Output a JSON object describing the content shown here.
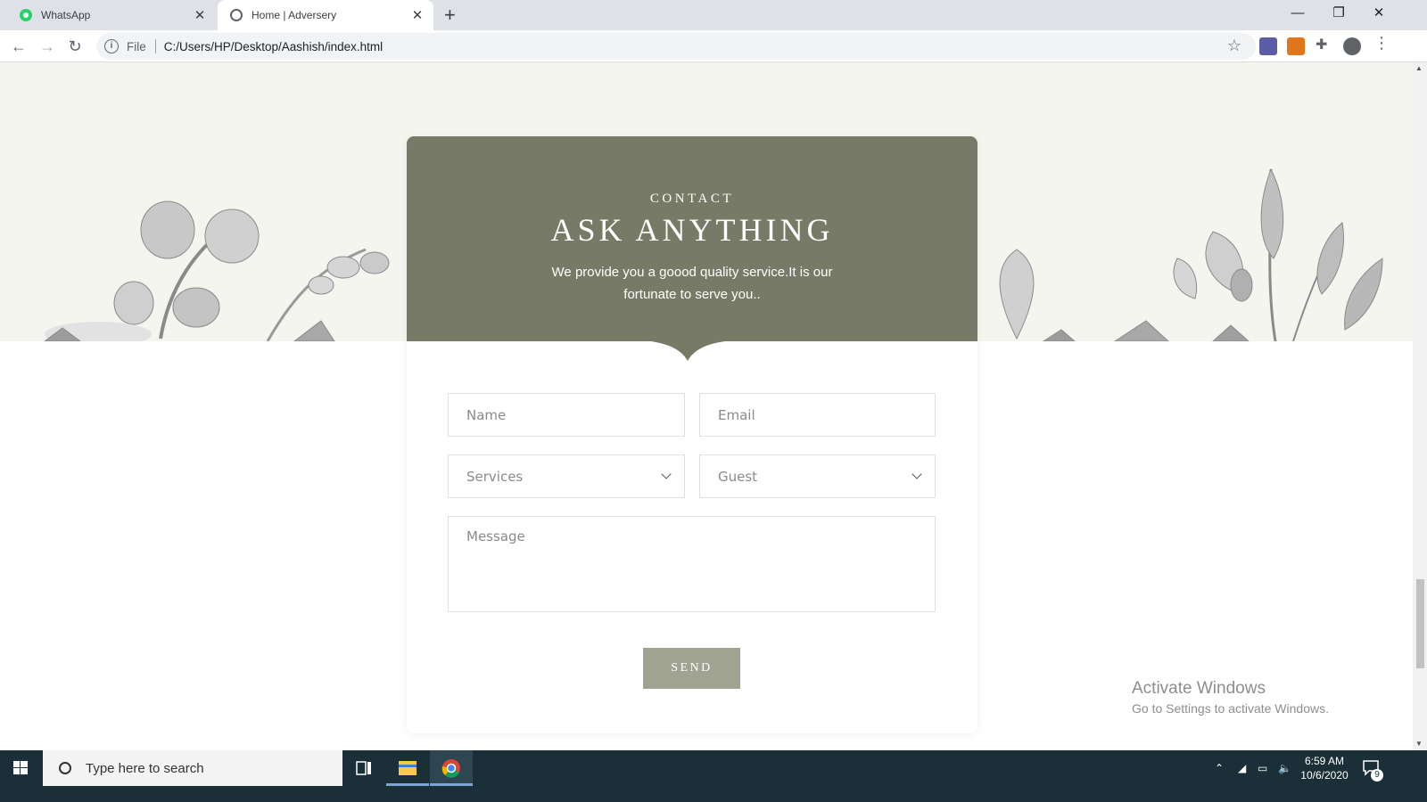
{
  "browser": {
    "tabs": [
      {
        "title": "WhatsApp",
        "favicon": "whatsapp-icon",
        "active": false
      },
      {
        "title": "Home | Adversery",
        "favicon": "globe-icon",
        "active": true
      }
    ],
    "new_tab": "+",
    "url_scheme": "File",
    "url": "C:/Users/HP/Desktop/Aashish/index.html",
    "window_controls": [
      "—",
      "❐",
      "✕"
    ]
  },
  "contact": {
    "eyebrow": "CONTACT",
    "heading": "ASK ANYTHING",
    "lede": "We provide you a goood quality service.It is our fortunate to serve you..",
    "form": {
      "name_placeholder": "Name",
      "email_placeholder": "Email",
      "services_value": "Services",
      "guest_value": "Guest",
      "message_placeholder": "Message",
      "send_label": "SEND"
    }
  },
  "watermark": {
    "line1": "Activate Windows",
    "line2": "Go to Settings to activate Windows."
  },
  "taskbar": {
    "search_placeholder": "Type here to search",
    "time": "6:59 AM",
    "date": "10/6/2020",
    "notification_count": "9"
  },
  "colors": {
    "header": "#767a66",
    "send_button": "#a0a391",
    "band": "#f5f5f0",
    "taskbar": "#1b2f38"
  }
}
